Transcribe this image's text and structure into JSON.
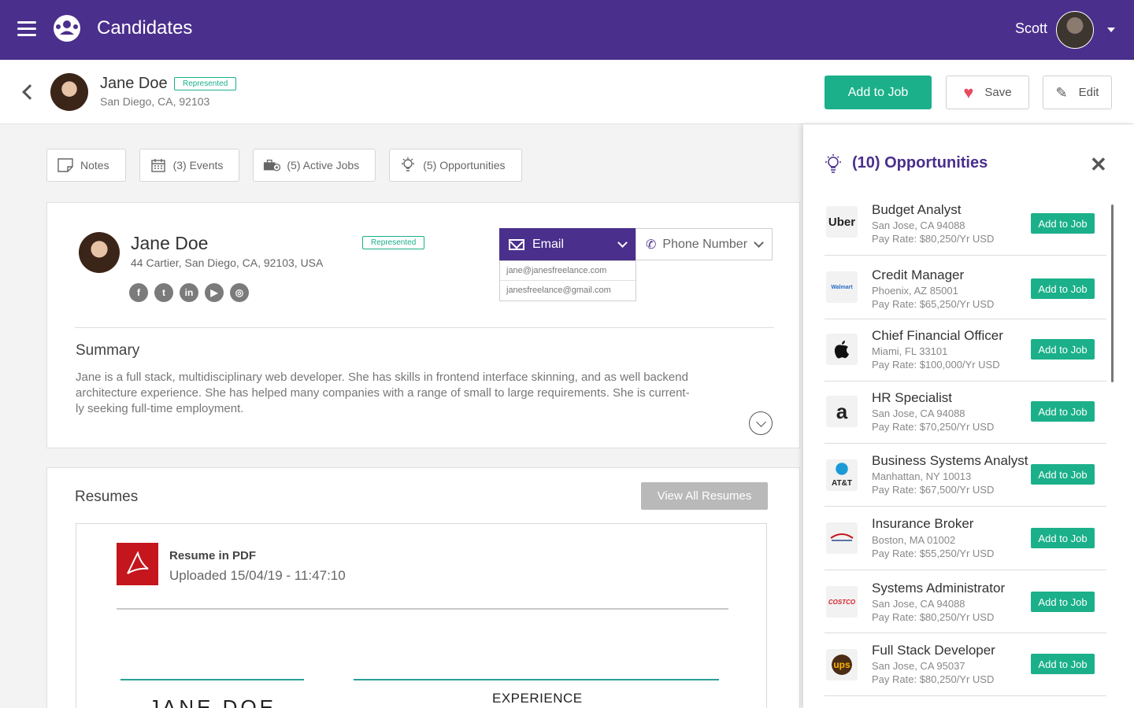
{
  "app": {
    "title": "Candidates",
    "user_name": "Scott"
  },
  "header": {
    "name": "Jane Doe",
    "badge": "Represented",
    "location": "San Diego, CA, 92103",
    "add_to_job": "Add to Job",
    "save": "Save",
    "edit": "Edit"
  },
  "tabs": [
    {
      "label": "Notes",
      "icon": "notes-icon"
    },
    {
      "label": "(3) Events",
      "icon": "calendar-icon"
    },
    {
      "label": "(5) Active Jobs",
      "icon": "briefcase-icon"
    },
    {
      "label": "(5) Opportunities",
      "icon": "lightbulb-icon"
    }
  ],
  "profile": {
    "name": "Jane Doe",
    "badge": "Represented",
    "address": "44 Cartier, San Diego, CA, 92103, USA",
    "socials": [
      {
        "name": "facebook-icon",
        "glyph": "f"
      },
      {
        "name": "twitter-icon",
        "glyph": "t"
      },
      {
        "name": "linkedin-icon",
        "glyph": "in"
      },
      {
        "name": "youtube-icon",
        "glyph": "▶"
      },
      {
        "name": "instagram-icon",
        "glyph": "◎"
      }
    ],
    "email_label": "Email",
    "phone_label": "Phone Number",
    "emails": [
      "jane@janesfreelance.com",
      "janesfreelance@gmail.com"
    ],
    "summary_title": "Summary",
    "summary_line1": "Jane is a full stack, multidisciplinary web developer. She has skills in frontend interface skinning, and as well backend",
    "summary_line2": "architecture experience. She has helped many companies with a range of small to large requirements. She is current-",
    "summary_line3": "ly seeking full-time employment."
  },
  "resumes": {
    "title": "Resumes",
    "view_all": "View All Resumes",
    "file_name": "Resume in PDF",
    "uploaded": "Uploaded 15/04/19 - 11:47:10",
    "doc_name": "JANE DOE",
    "doc_section": "EXPERIENCE"
  },
  "opportunities": {
    "title": "(10) Opportunities",
    "items": [
      {
        "company_logo": "Uber",
        "title": "Budget Analyst",
        "location": "San Jose, CA  94088",
        "rate": "Pay Rate: $80,250/Yr USD",
        "action": "Add to Job"
      },
      {
        "company_logo": "Walmart",
        "title": "Credit Manager",
        "location": "Phoenix, AZ  85001",
        "rate": "Pay Rate: $65,250/Yr USD",
        "action": "Add to Job"
      },
      {
        "company_logo": "",
        "title": "Chief Financial Officer",
        "location": "Miami, FL  33101",
        "rate": "Pay Rate: $100,000/Yr USD",
        "action": "Add to Job"
      },
      {
        "company_logo": "a",
        "title": "HR Specialist",
        "location": "San Jose, CA  94088",
        "rate": "Pay Rate: $70,250/Yr USD",
        "action": "Add to Job"
      },
      {
        "company_logo": "AT&T",
        "title": "Business Systems Analyst",
        "location": "Manhattan, NY  10013",
        "rate": "Pay Rate: $67,500/Yr USD",
        "action": "Add to Job"
      },
      {
        "company_logo": "",
        "title": "Insurance Broker",
        "location": "Boston, MA  01002",
        "rate": "Pay Rate: $55,250/Yr USD",
        "action": "Add to Job"
      },
      {
        "company_logo": "COSTCO",
        "title": "Systems Administrator",
        "location": "San Jose, CA  94088",
        "rate": "Pay Rate: $80,250/Yr USD",
        "action": "Add to Job"
      },
      {
        "company_logo": "ups",
        "title": "Full Stack Developer",
        "location": "San Jose, CA  95037",
        "rate": "Pay Rate: $80,250/Yr USD",
        "action": "Add to Job"
      }
    ]
  },
  "colors": {
    "brand": "#4a2f8c",
    "accent": "#1bb08a",
    "heart": "#e84a5f"
  }
}
